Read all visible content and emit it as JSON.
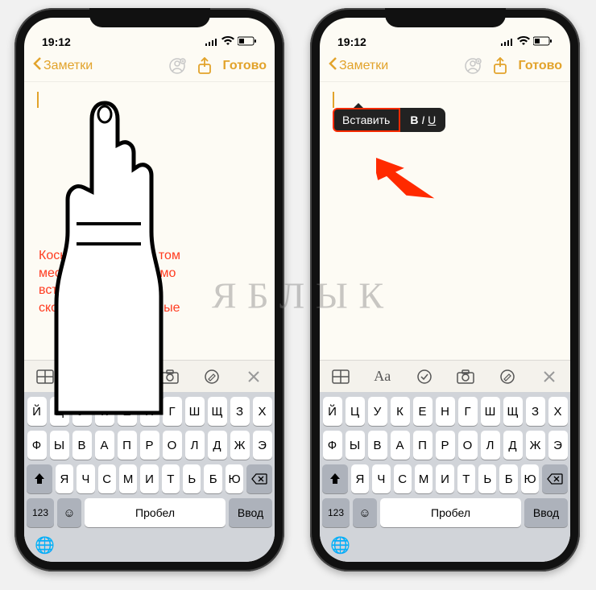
{
  "watermark": "Я Б Л Ы К",
  "status": {
    "time": "19:12",
    "signal_icon": "signal-icon",
    "wifi_icon": "wifi-icon",
    "battery_icon": "battery-icon"
  },
  "nav": {
    "back_label": "Заметки",
    "done_label": "Готово"
  },
  "context_menu": {
    "paste_label": "Вставить",
    "format_label": "B I U"
  },
  "instruction_text": "Коснитесь экрана в том месте, где необходимо вставить скопированные данные",
  "toolbar_icons": {
    "table": "table-icon",
    "aa": "Aa",
    "check": "check-icon",
    "camera": "camera-icon",
    "draw": "draw-icon",
    "close": "close-icon"
  },
  "keyboard": {
    "row1": [
      "й",
      "ц",
      "у",
      "к",
      "е",
      "н",
      "г",
      "ш",
      "щ",
      "з",
      "х"
    ],
    "row2": [
      "ф",
      "ы",
      "в",
      "а",
      "п",
      "р",
      "о",
      "л",
      "д",
      "ж",
      "э"
    ],
    "row3": [
      "я",
      "ч",
      "с",
      "м",
      "и",
      "т",
      "ь",
      "б",
      "ю"
    ],
    "mode_label": "123",
    "space_label": "Пробел",
    "enter_label": "Ввод"
  }
}
